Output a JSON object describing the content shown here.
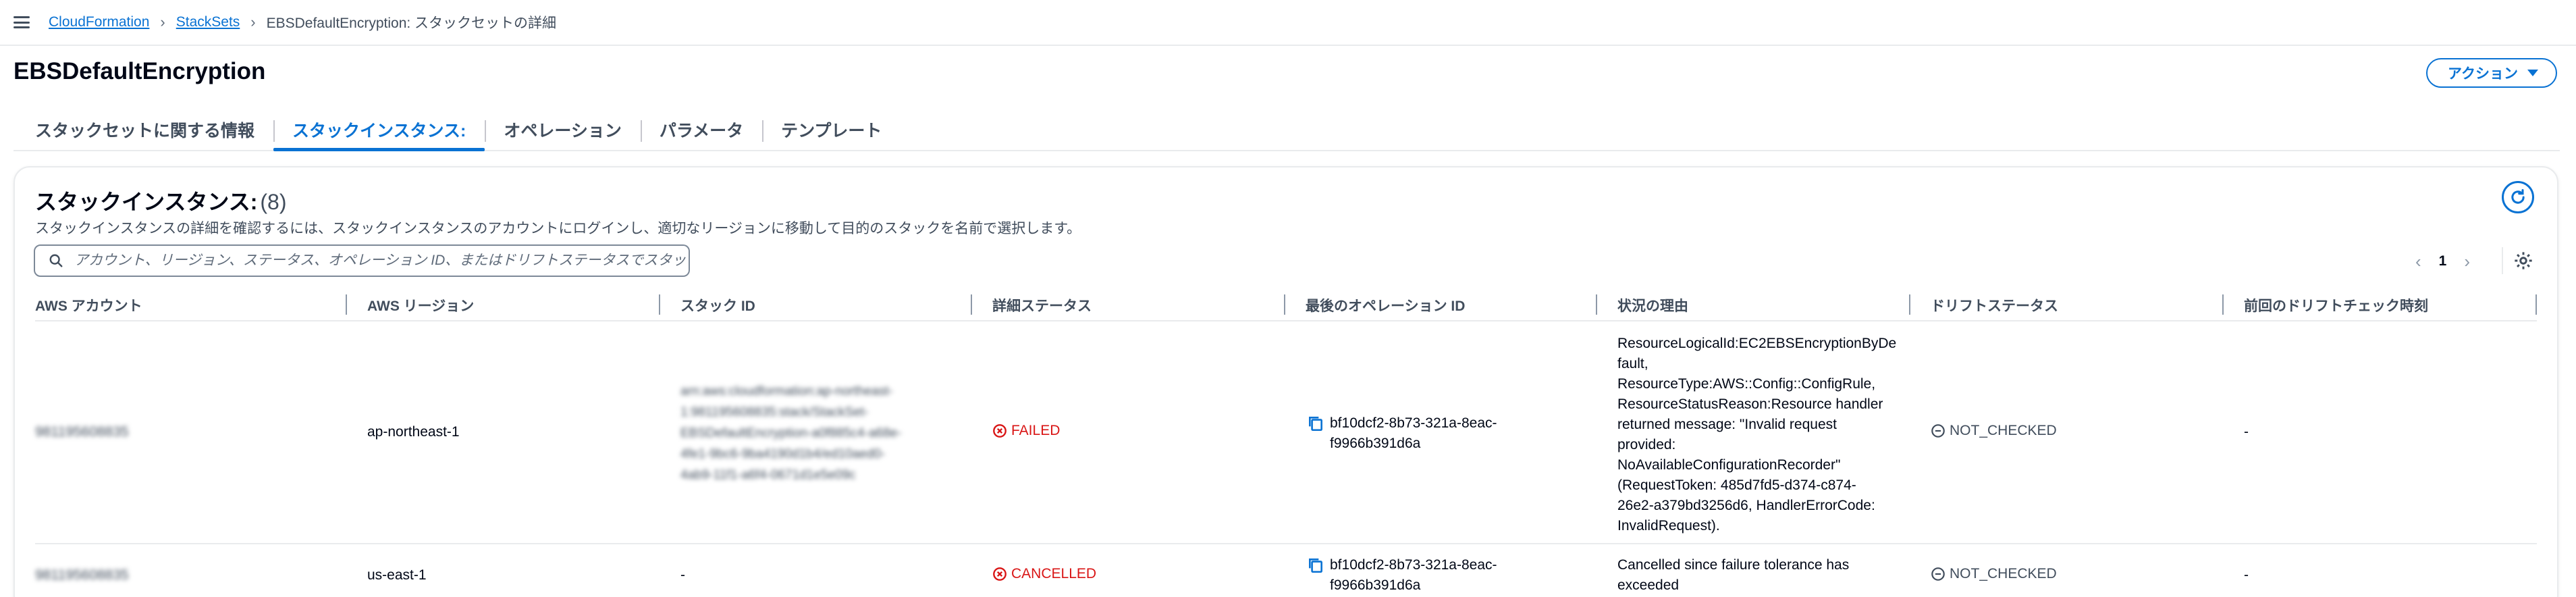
{
  "breadcrumb": {
    "items": [
      "CloudFormation",
      "StackSets"
    ],
    "current": "EBSDefaultEncryption: スタックセットの詳細"
  },
  "page": {
    "title": "EBSDefaultEncryption",
    "action_label": "アクション"
  },
  "tabs": [
    {
      "label": "スタックセットに関する情報",
      "active": false
    },
    {
      "label": "スタックインスタンス:",
      "active": true
    },
    {
      "label": "オペレーション",
      "active": false
    },
    {
      "label": "パラメータ",
      "active": false
    },
    {
      "label": "テンプレート",
      "active": false
    }
  ],
  "panel": {
    "title": "スタックインスタンス:",
    "count": "(8)",
    "description": "スタックインスタンスの詳細を確認するには、スタックインスタンスのアカウントにログインし、適切なリージョンに移動して目的のスタックを名前で選択します。",
    "search_placeholder": "アカウント、リージョン、ステータス、オペレーション ID、またはドリフトステータスでスタックインスタンスを検索",
    "page_number": "1"
  },
  "table": {
    "columns": [
      "AWS アカウント",
      "AWS リージョン",
      "スタック ID",
      "詳細ステータス",
      "最後のオペレーション ID",
      "状況の理由",
      "ドリフトステータス",
      "前回のドリフトチェック時刻"
    ],
    "rows": [
      {
        "account": "981195608835",
        "region": "ap-northeast-1",
        "stack_id": [
          "arn:aws:cloudformation:ap-northeast-",
          "1:981195608835:stack/StackSet-",
          "EBSDefaultEncryption-a0f885c4-a68e-",
          "4fe1-9bc6-9ba4190d1b4/ed10aed0-",
          "4ab9-11f1-a6f4-0671d1e5e09c"
        ],
        "detail_status": "FAILED",
        "operation_id": [
          "bf10dcf2-8b73-321a-8eac-",
          "f9966b391d6a"
        ],
        "reason": [
          "ResourceLogicalId:EC2EBSEncryptionByDe",
          "fault,",
          "ResourceType:AWS::Config::ConfigRule,",
          "ResourceStatusReason:Resource handler",
          "returned message: \"Invalid request",
          "provided:",
          "NoAvailableConfigurationRecorder\"",
          "(RequestToken: 485d7fd5-d374-c874-",
          "26e2-a379bd3256d6, HandlerErrorCode:",
          "InvalidRequest)."
        ],
        "drift_status": "NOT_CHECKED",
        "last_drift_check": "-"
      },
      {
        "account": "981195608835",
        "region": "us-east-1",
        "stack_id": [
          "-"
        ],
        "detail_status": "CANCELLED",
        "operation_id": [
          "bf10dcf2-8b73-321a-8eac-",
          "f9966b391d6a"
        ],
        "reason": [
          "Cancelled since failure tolerance has",
          "exceeded"
        ],
        "drift_status": "NOT_CHECKED",
        "last_drift_check": "-"
      }
    ]
  },
  "colors": {
    "link": "#0972d3",
    "error": "#d91515",
    "text_secondary": "#414d5c",
    "border": "#e9ebed"
  },
  "icons": [
    "menu-icon",
    "chevron-right-icon",
    "caret-down-icon",
    "refresh-icon",
    "search-icon",
    "chevron-left-icon",
    "settings-icon",
    "error-icon",
    "copy-icon",
    "not-checked-icon"
  ]
}
